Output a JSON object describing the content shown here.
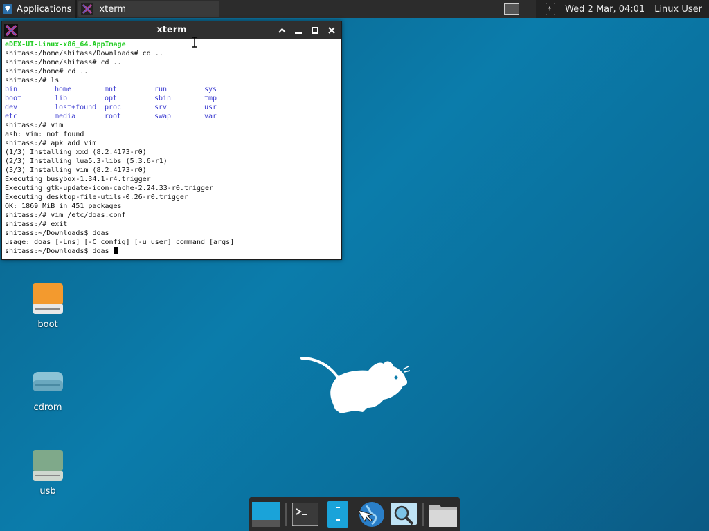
{
  "panel": {
    "apps_label": "Applications",
    "task_label": "xterm",
    "datetime": "Wed  2 Mar, 04:01",
    "user": "Linux User"
  },
  "window": {
    "title": "xterm",
    "lines_top": [
      {
        "text": "eDEX-UI-Linux-x86_64.AppImage",
        "style": "green"
      },
      {
        "text": "shitass:/home/shitass/Downloads# cd .."
      },
      {
        "text": "shitass:/home/shitass# cd .."
      },
      {
        "text": "shitass:/home# cd .."
      },
      {
        "text": "shitass:/# ls"
      }
    ],
    "ls_rows": [
      [
        "bin",
        "home",
        "mnt",
        "run",
        "sys"
      ],
      [
        "boot",
        "lib",
        "opt",
        "sbin",
        "tmp"
      ],
      [
        "dev",
        "lost+found",
        "proc",
        "srv",
        "usr"
      ],
      [
        "etc",
        "media",
        "root",
        "swap",
        "var"
      ]
    ],
    "lines_bottom": [
      "shitass:/# vim",
      "ash: vim: not found",
      "shitass:/# apk add vim",
      "(1/3) Installing xxd (8.2.4173-r0)",
      "(2/3) Installing lua5.3-libs (5.3.6-r1)",
      "(3/3) Installing vim (8.2.4173-r0)",
      "Executing busybox-1.34.1-r4.trigger",
      "Executing gtk-update-icon-cache-2.24.33-r0.trigger",
      "Executing desktop-file-utils-0.26-r0.trigger",
      "OK: 1869 MiB in 451 packages",
      "shitass:/# vim /etc/doas.conf",
      "shitass:/# exit",
      "shitass:~/Downloads$ doas",
      "usage: doas [-Lns] [-C config] [-u user] command [args]"
    ],
    "prompt_line": "shitass:~/Downloads$ doas "
  },
  "desktop": {
    "icons": [
      {
        "label": "boot",
        "color": "#f39a2e"
      },
      {
        "label": "cdrom",
        "color": "#8cc3d6"
      },
      {
        "label": "usb",
        "color": "#7fa98a"
      }
    ]
  },
  "colors": {
    "accent": "#0b7cab",
    "ls_dir": "#3b3bd0",
    "green": "#22cc22"
  }
}
